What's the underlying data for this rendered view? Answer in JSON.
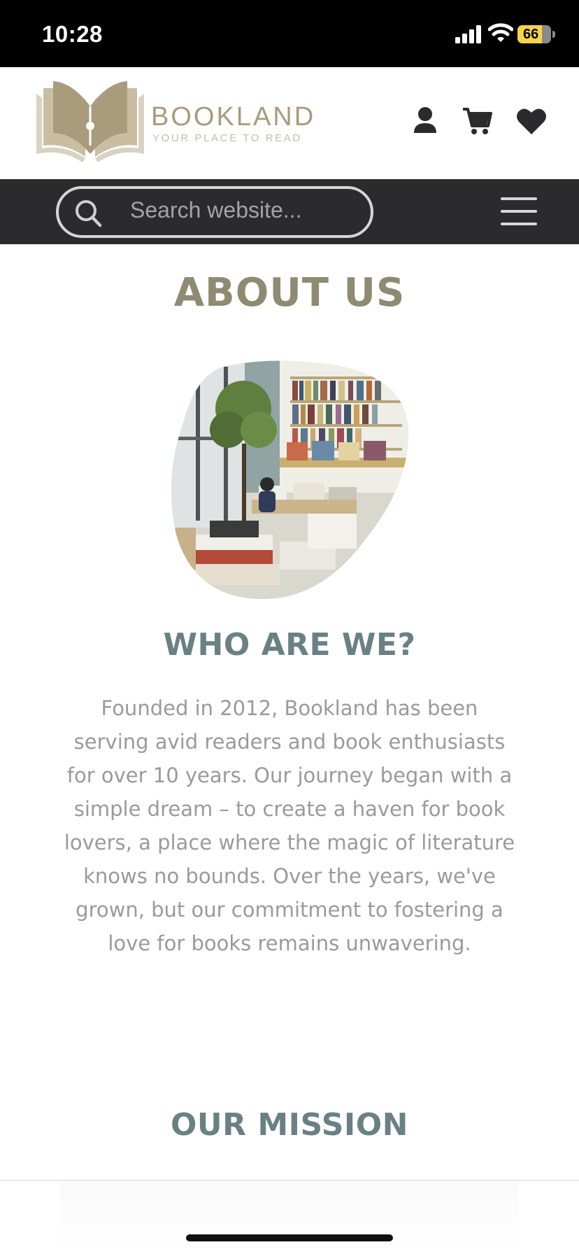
{
  "status_bar": {
    "time": "10:28",
    "battery_level": "66",
    "icons": [
      "signal-icon",
      "wifi-icon",
      "battery-icon"
    ]
  },
  "header": {
    "brand_name": "BOOKLAND",
    "tagline": "YOUR PLACE TO READ",
    "icons": [
      "user-icon",
      "cart-icon",
      "heart-icon"
    ],
    "brand_color": "#a99b7c"
  },
  "search": {
    "placeholder": "Search website..."
  },
  "nav": {
    "menu_icon": "hamburger-menu-icon"
  },
  "main": {
    "page_title": "ABOUT US",
    "who_title": "WHO ARE WE?",
    "who_text": "Founded in 2012, Bookland has been serving avid readers and book enthusiasts for over 10 years. Our journey began with a simple dream – to create a haven for book lovers, a place where the magic of literature knows no bounds. Over the years, we've grown, but our commitment to fostering a love for books remains unwavering.",
    "mission_title": "OUR MISSION"
  },
  "colors": {
    "title": "#8f8b72",
    "section_title": "#6a8184",
    "body_text": "#9a9a9a",
    "search_bar_bg": "#2b2a2c"
  }
}
